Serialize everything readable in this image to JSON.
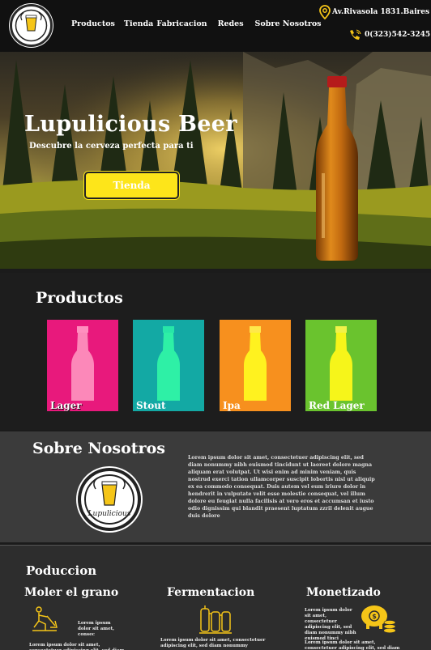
{
  "nav": {
    "logo_text": "Lupulicious",
    "links": [
      "Productos",
      "Tienda",
      "Fabricacion",
      "Redes",
      "Sobre Nosotros"
    ],
    "address": "Av.Rivasola 1831.Baires",
    "phone": "0(323)542-3245"
  },
  "hero": {
    "title": "Lupulicious Beer",
    "subtitle": "Descubre la cerveza perfecta para ti",
    "button_label": "Tienda"
  },
  "productos": {
    "title": "Productos",
    "items": [
      {
        "label": "Lager",
        "color": "#e8197c"
      },
      {
        "label": "Stout",
        "color": "#13a9a4"
      },
      {
        "label": "Ipa",
        "color": "#f7901e"
      },
      {
        "label": "Red Lager",
        "color": "#6ac32e"
      }
    ]
  },
  "sobre": {
    "title": "Sobre Nosotros",
    "text": "Lorem ipsum dolor sit amet, consectetuer adipiscing elit, sed diam nonummy nibh euismod tincidunt ut laoreet dolore magna aliquam erat volutpat. Ut wisi enim ad minim veniam, quis nostrud exerci tation ullamcorper suscipit lobortis nisl ut aliquip ex ea commodo consequat. Duis autem vel eum iriure dolor in hendrerit in vulputate velit esse molestie consequat, vel illum dolore eu feugiat nulla facilisis at vero eros et accumsan et iusto odio dignissim qui blandit praesent luptatum zzril delenit augue duis dolore"
  },
  "produccion": {
    "title": "Poduccion",
    "steps": [
      {
        "title": "Moler el grano",
        "text_side": "Lorem ipsum dolor sit amet, consec",
        "text_bottom": "Lorem ipsum dolor sit amet, consectetuer adipiscing elit, sed diam no"
      },
      {
        "title": "Fermentacion",
        "text_bottom": "Lorem ipsum dolor sit amet, consectetuer adipiscing elit, sed diam nonummy"
      },
      {
        "title": "Monetizado",
        "text_side": "Lorem ipsum dolor sit amet, consectetuer adipiscing elit, sed diam nonummy nibh euismod tinci",
        "text_bottom": "Lorem ipsum dolor sit amet, consectetuer adipiscing elit, sed diam no"
      }
    ]
  },
  "colors": {
    "accent": "#fde51a",
    "icon_yellow": "#f5c518"
  }
}
